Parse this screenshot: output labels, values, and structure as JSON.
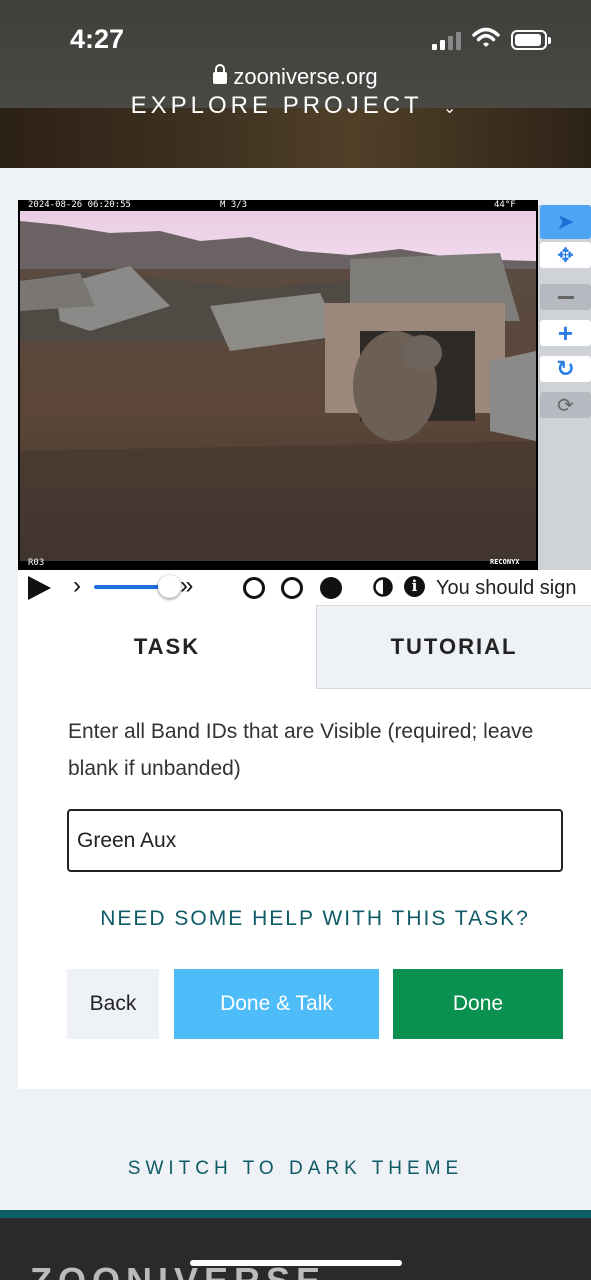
{
  "status_bar": {
    "time": "4:27"
  },
  "browser": {
    "url": "zooniverse.org"
  },
  "project_nav": {
    "label": "EXPLORE PROJECT"
  },
  "image": {
    "timestamp": "2024-08-26 06:20:55",
    "frame": "M 3/3",
    "temperature": "44°F",
    "camera_id": "R03",
    "brand": "RECONYX"
  },
  "viewer_controls": {
    "message": "You should sign"
  },
  "tabs": {
    "task": "TASK",
    "tutorial": "TUTORIAL"
  },
  "task": {
    "question": "Enter all Band IDs that are Visible (required; leave blank if unbanded)",
    "answer_value": "Green Aux",
    "help_link": "NEED SOME HELP WITH THIS TASK?"
  },
  "buttons": {
    "back": "Back",
    "done_talk": "Done & Talk",
    "done": "Done"
  },
  "theme_toggle": "SWITCH TO DARK THEME",
  "footer": {
    "logo": "ZOONIVERSE"
  },
  "colors": {
    "accent_teal": "#0f5b66",
    "done_green": "#0a9150",
    "talk_blue": "#4dbcf8",
    "tool_selected": "#4ea4f4"
  }
}
